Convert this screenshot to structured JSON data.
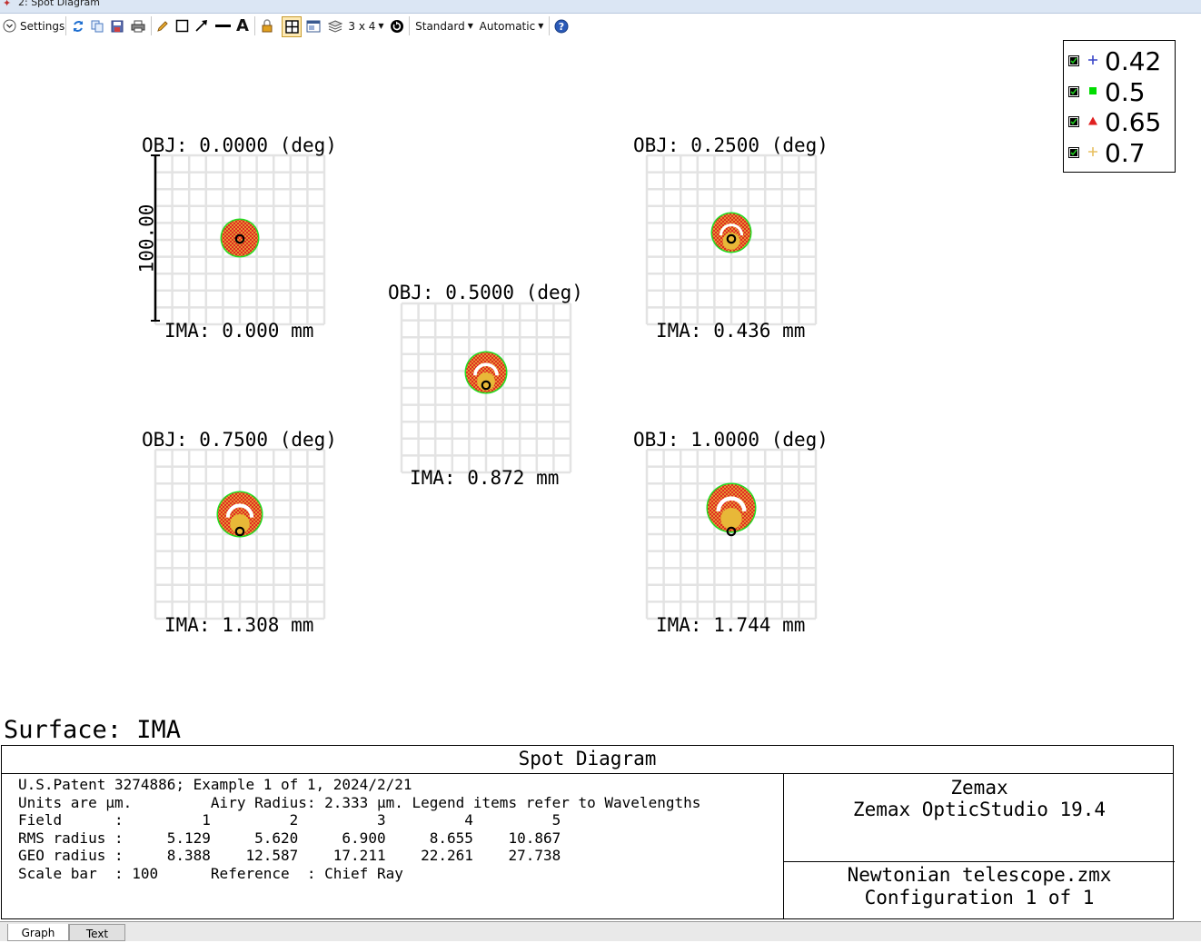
{
  "window": {
    "title": "2: Spot Diagram"
  },
  "toolbar": {
    "settings_label": "Settings",
    "layout_label": "3 x 4",
    "standard_label": "Standard",
    "automatic_label": "Automatic",
    "icons": [
      "chevron-down-icon",
      "refresh-icon",
      "copy-icon",
      "save-icon",
      "print-icon",
      "pencil-icon",
      "rectangle-icon",
      "arrow-icon",
      "line-icon",
      "text-icon",
      "lock-icon",
      "grid-layout-icon",
      "window-icon",
      "layers-icon",
      "rotate-icon",
      "help-icon"
    ]
  },
  "spots": [
    {
      "obj": "OBJ: 0.0000 (deg)",
      "ima": "IMA: 0.000 mm"
    },
    {
      "obj": "OBJ: 0.2500 (deg)",
      "ima": "IMA: 0.436 mm"
    },
    {
      "obj": "OBJ: 0.5000 (deg)",
      "ima": "IMA: 0.872 mm"
    },
    {
      "obj": "OBJ: 0.7500 (deg)",
      "ima": "IMA: 1.308 mm"
    },
    {
      "obj": "OBJ: 1.0000 (deg)",
      "ima": "IMA: 1.744 mm"
    }
  ],
  "scale_bar_label": "100.00",
  "legend": [
    {
      "label": "0.42",
      "symbol": "plus",
      "color": "#3a46c8"
    },
    {
      "label": "0.5",
      "symbol": "square",
      "color": "#00cc00"
    },
    {
      "label": "0.65",
      "symbol": "triangle",
      "color": "#e02020"
    },
    {
      "label": "0.7",
      "symbol": "plus",
      "color": "#e8c060"
    }
  ],
  "surface_label": "Surface: IMA",
  "info": {
    "title": "Spot Diagram",
    "line1": "U.S.Patent 3274886; Example 1 of 1, 2024/2/21",
    "line2": "Units are µm.         Airy Radius: 2.333 µm. Legend items refer to Wavelengths",
    "line3": "Field      :         1         2         3         4         5",
    "line4": "RMS radius :     5.129     5.620     6.900     8.655    10.867",
    "line5": "GEO radius :     8.388    12.587    17.211    22.261    27.738",
    "line6": "Scale bar  : 100      Reference  : Chief Ray",
    "company": "Zemax",
    "product": "Zemax OpticStudio 19.4",
    "file": "Newtonian telescope.zmx",
    "config": "Configuration 1 of 1"
  },
  "tabs": {
    "graph": "Graph",
    "text": "Text"
  }
}
